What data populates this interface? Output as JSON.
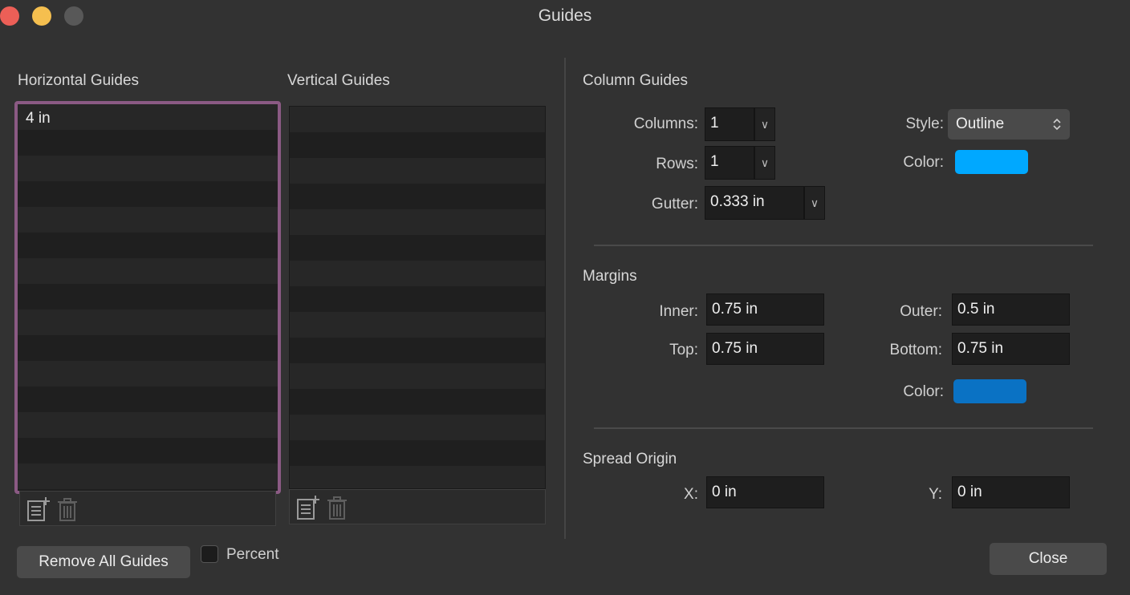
{
  "window": {
    "title": "Guides"
  },
  "horizontal": {
    "label": "Horizontal Guides",
    "items": [
      "4 in"
    ]
  },
  "vertical": {
    "label": "Vertical Guides",
    "items": []
  },
  "icons": {
    "add": "add-guide-icon",
    "delete": "trash-icon"
  },
  "column_guides": {
    "label": "Column Guides",
    "columns_label": "Columns:",
    "columns_value": "1",
    "rows_label": "Rows:",
    "rows_value": "1",
    "gutter_label": "Gutter:",
    "gutter_value": "0.333 in",
    "style_label": "Style:",
    "style_value": "Outline",
    "color_label": "Color:",
    "color": "#00a8ff"
  },
  "margins": {
    "label": "Margins",
    "inner_label": "Inner:",
    "inner_value": "0.75 in",
    "outer_label": "Outer:",
    "outer_value": "0.5 in",
    "top_label": "Top:",
    "top_value": "0.75 in",
    "bottom_label": "Bottom:",
    "bottom_value": "0.75 in",
    "color_label": "Color:",
    "color": "#0a72c4"
  },
  "spread_origin": {
    "label": "Spread Origin",
    "x_label": "X:",
    "x_value": "0 in",
    "y_label": "Y:",
    "y_value": "0 in"
  },
  "footer": {
    "remove_all_label": "Remove All Guides",
    "percent_label": "Percent",
    "percent_checked": false,
    "close_label": "Close"
  }
}
